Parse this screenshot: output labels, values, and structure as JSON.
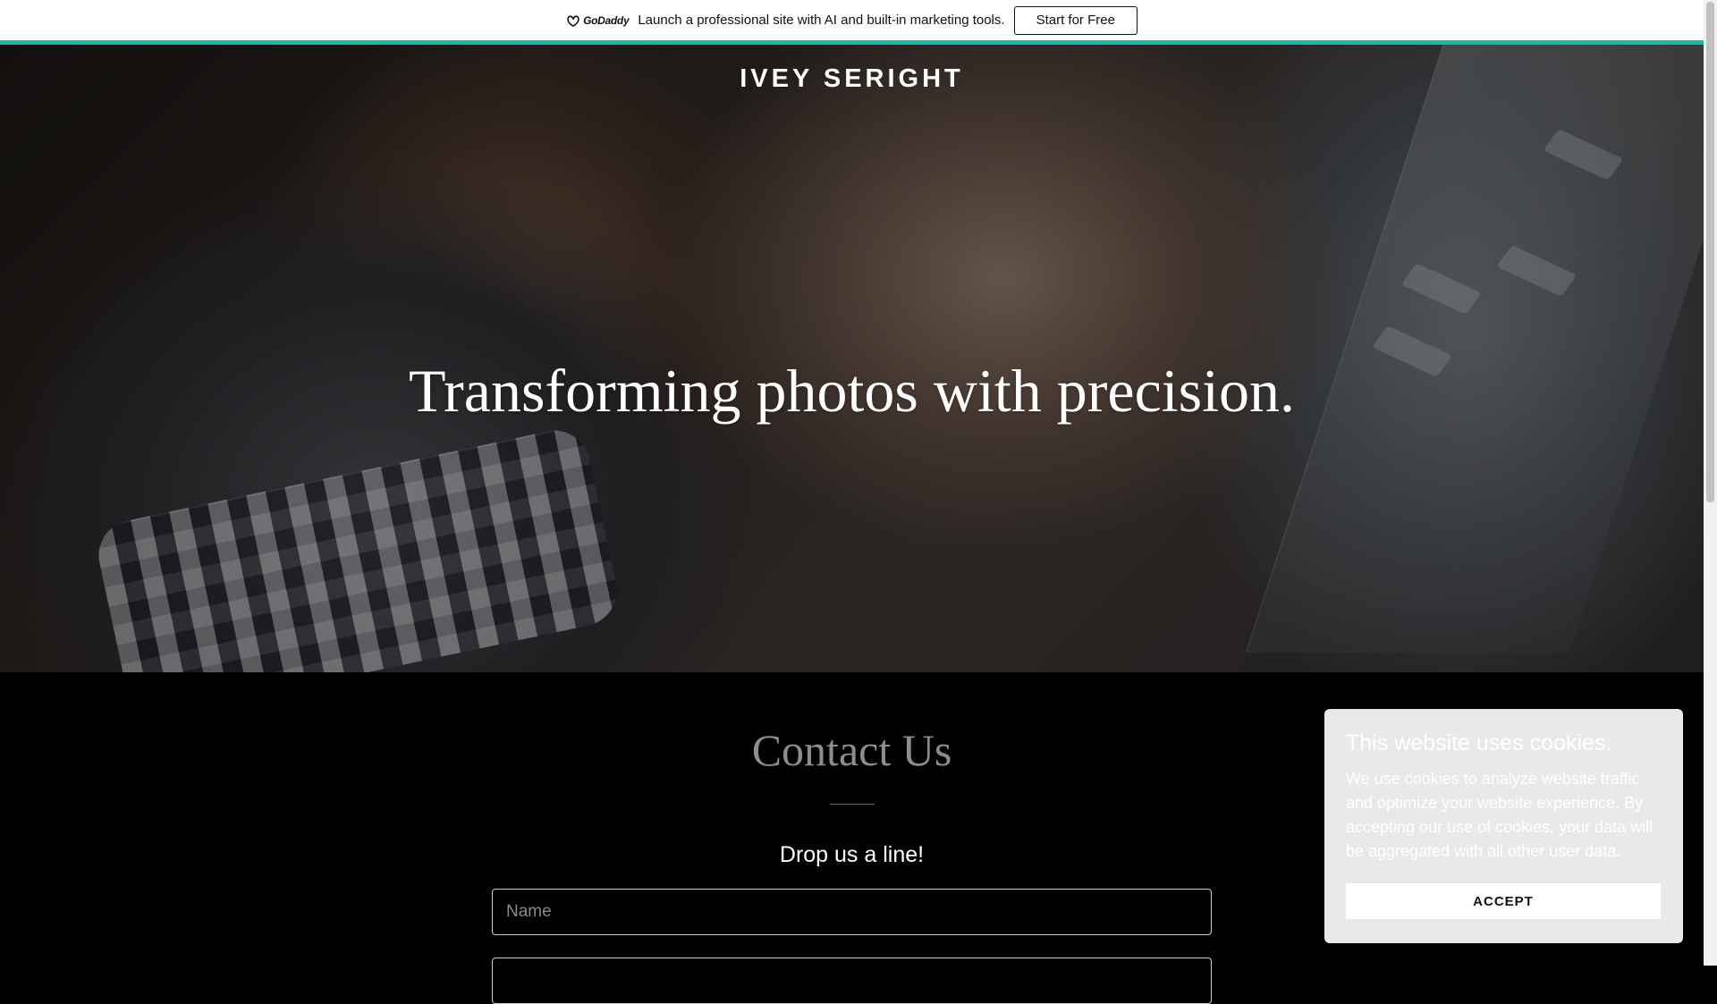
{
  "promo": {
    "logo_text": "GoDaddy",
    "text": "Launch a professional site with AI and built-in marketing tools.",
    "button_label": "Start for Free"
  },
  "hero": {
    "site_title": "IVEY SERIGHT",
    "heading": "Transforming photos with precision."
  },
  "contact": {
    "title": "Contact Us",
    "subtitle": "Drop us a line!",
    "name_placeholder": "Name",
    "email_placeholder": ""
  },
  "cookie": {
    "title": "This website uses cookies.",
    "body": "We use cookies to analyze website traffic and optimize your website experience. By accepting our use of cookies, your data will be aggregated with all other user data.",
    "accept_label": "ACCEPT"
  },
  "colors": {
    "accent": "#1bb8ad",
    "page_background": "#000000",
    "cookie_background": "#e9e9e9"
  }
}
